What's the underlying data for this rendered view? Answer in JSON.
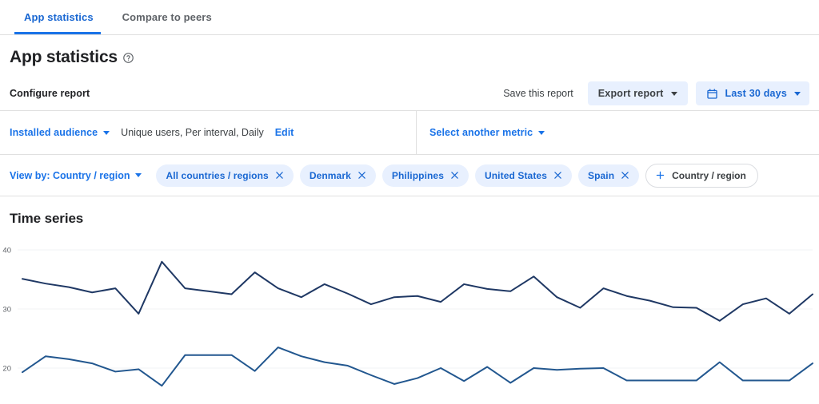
{
  "tabs": [
    {
      "label": "App statistics",
      "active": true
    },
    {
      "label": "Compare to peers",
      "active": false
    }
  ],
  "header": {
    "title": "App statistics",
    "help_icon": "help-circle-icon"
  },
  "configure": {
    "label": "Configure report",
    "save_label": "Save this report",
    "export_label": "Export report",
    "date_range_label": "Last 30 days",
    "calendar_icon": "calendar-icon",
    "caret_icon": "chevron-down-icon"
  },
  "metric": {
    "audience_label": "Installed audience",
    "description": "Unique users, Per interval, Daily",
    "edit_label": "Edit",
    "select_metric_label": "Select another metric"
  },
  "filters": {
    "view_by_label": "View by: Country / region",
    "chips": [
      {
        "label": "All countries / regions",
        "remove_icon": "close-icon"
      },
      {
        "label": "Denmark",
        "remove_icon": "close-icon"
      },
      {
        "label": "Philippines",
        "remove_icon": "close-icon"
      },
      {
        "label": "United States",
        "remove_icon": "close-icon"
      },
      {
        "label": "Spain",
        "remove_icon": "close-icon"
      }
    ],
    "add_chip": {
      "label": "Country / region",
      "icon": "plus-icon"
    }
  },
  "colors": {
    "accent": "#1a73e8",
    "chip_bg": "#e8f0fe",
    "series_1": "#1f3864",
    "series_2": "#22578f",
    "grid": "#f1f3f4"
  },
  "chart_data": {
    "type": "line",
    "title": "Time series",
    "xlabel": "",
    "ylabel": "",
    "ylim": [
      13,
      42
    ],
    "yticks": [
      40,
      30,
      20
    ],
    "ytick_labels": [
      "40",
      "30",
      "20"
    ],
    "grid": true,
    "legend": "none",
    "x": [
      1,
      2,
      3,
      4,
      5,
      6,
      7,
      8,
      9,
      10,
      11,
      12,
      13,
      14,
      15,
      16,
      17,
      18,
      19,
      20,
      21,
      22,
      23,
      24,
      25,
      26,
      27,
      28,
      29,
      30
    ],
    "series": [
      {
        "name": "series-1",
        "color": "#1f3864",
        "values": [
          35.1,
          34.3,
          33.7,
          32.8,
          33.5,
          29.2,
          38.0,
          33.5,
          33.0,
          32.5,
          36.2,
          33.5,
          32.0,
          34.2,
          32.6,
          30.8,
          32.0,
          32.2,
          31.2,
          34.2,
          33.4,
          33.0,
          35.5,
          32.0,
          30.2,
          33.5,
          32.2,
          31.4,
          30.3,
          30.2,
          28.0,
          30.8,
          31.8,
          29.2,
          32.5
        ]
      },
      {
        "name": "series-2",
        "color": "#22578f",
        "values": [
          19.3,
          22.0,
          21.5,
          20.8,
          19.4,
          19.8,
          17.0,
          22.2,
          22.2,
          22.2,
          19.5,
          23.5,
          22.0,
          21.0,
          20.4,
          18.8,
          17.3,
          18.3,
          20.0,
          17.8,
          20.2,
          17.5,
          20.0,
          19.7,
          19.9,
          20.0,
          17.9,
          17.9,
          17.9,
          17.9,
          21.0,
          17.9,
          17.9,
          17.9,
          20.8
        ]
      }
    ]
  }
}
